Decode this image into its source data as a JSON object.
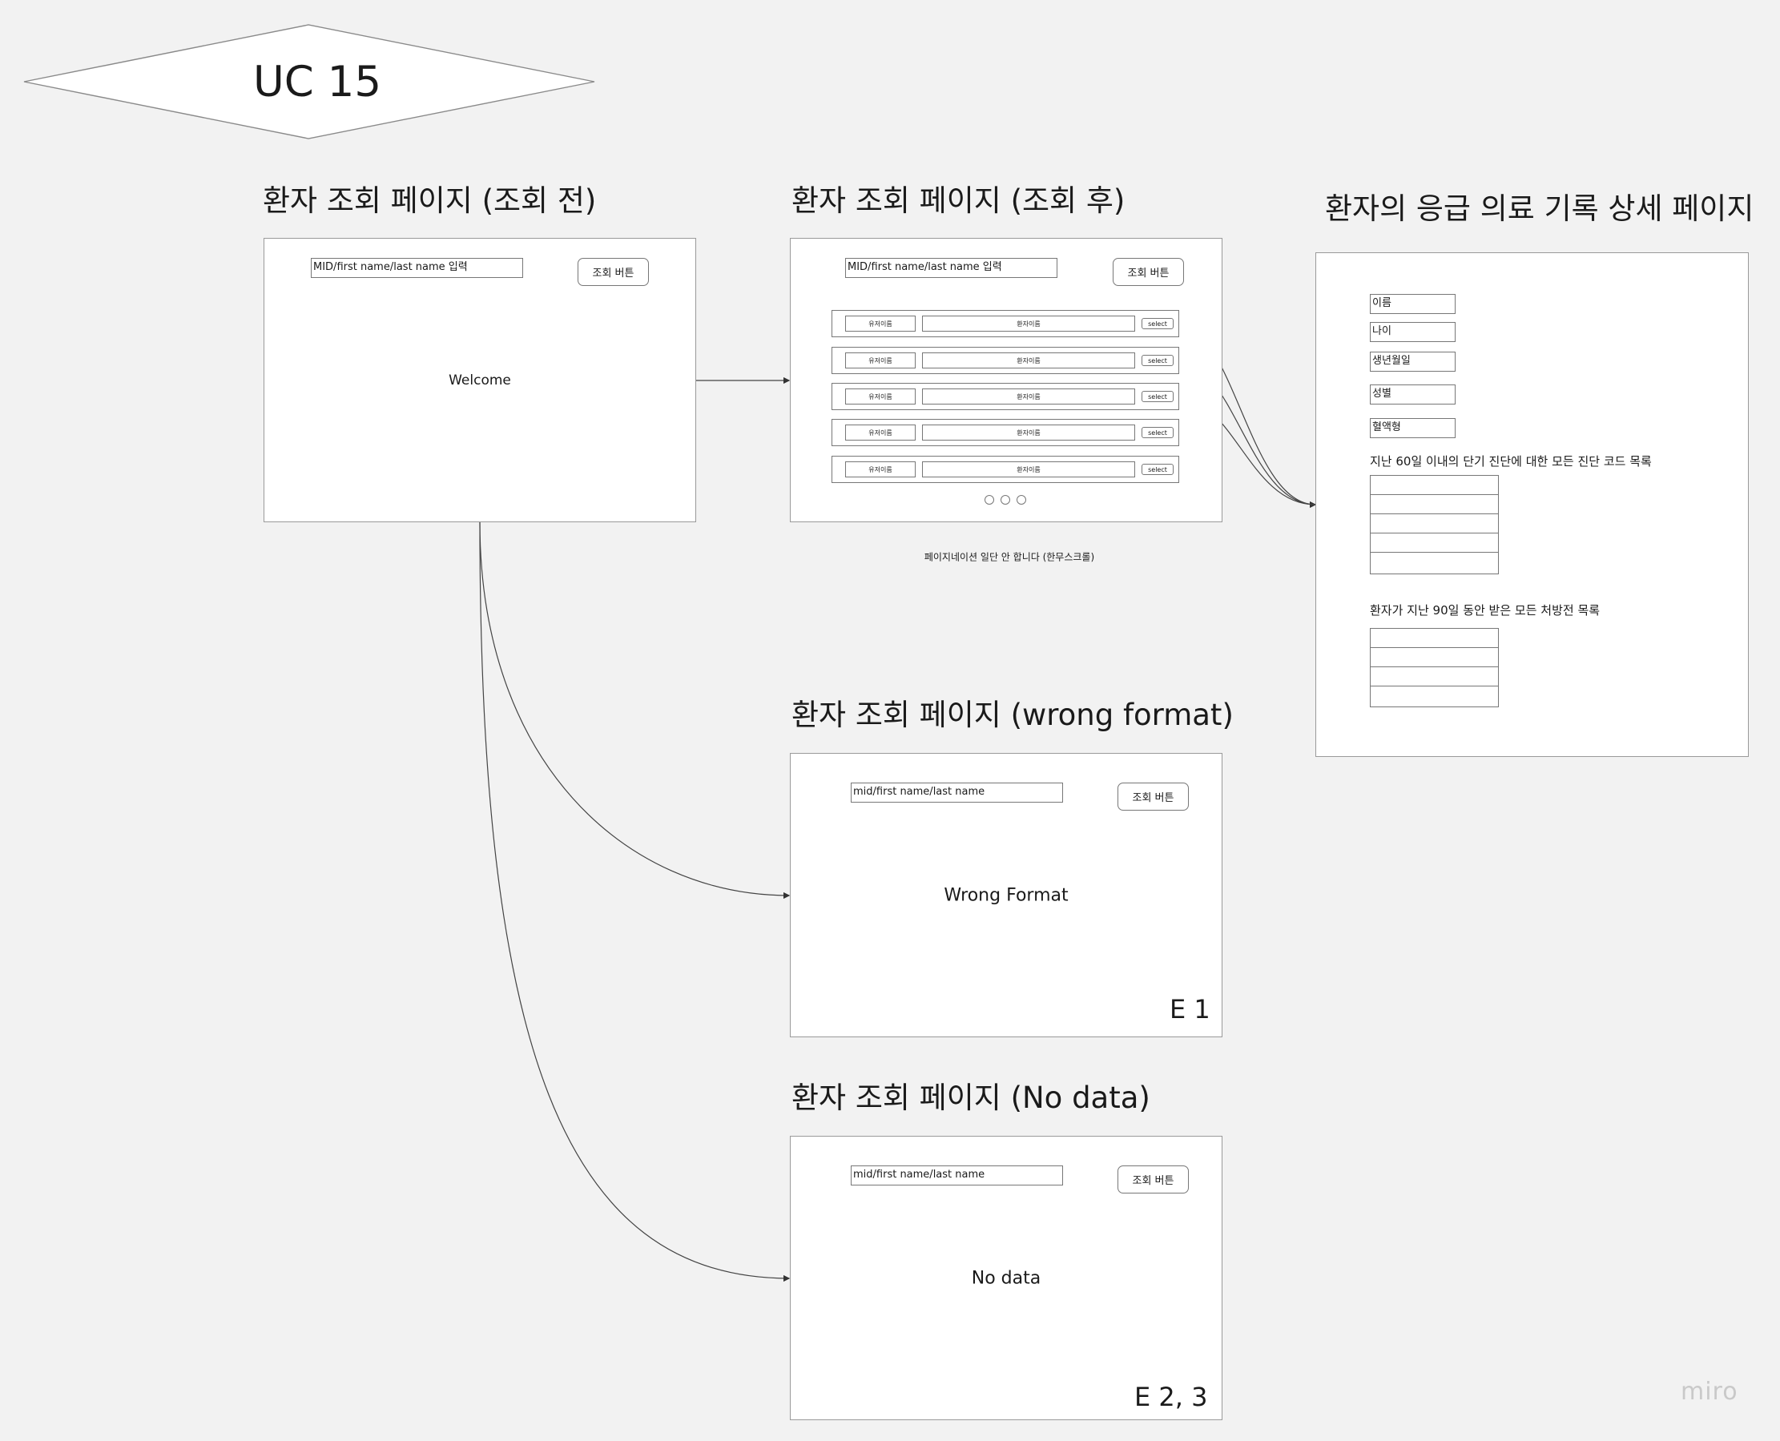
{
  "title": "UC 15",
  "screens": {
    "before": {
      "heading": "환자 조회 페이지 (조회 전)",
      "input_value": "MID/first name/last name 입력",
      "button_label": "조회 버튼",
      "message": "Welcome"
    },
    "after": {
      "heading": "환자 조회 페이지 (조회 후)",
      "input_value": "MID/first name/last name 입력",
      "button_label": "조회 버튼",
      "rows": [
        {
          "user_name": "유저이름",
          "patient_name": "환자이름",
          "select_label": "select"
        },
        {
          "user_name": "유저이름",
          "patient_name": "환자이름",
          "select_label": "select"
        },
        {
          "user_name": "유저이름",
          "patient_name": "환자이름",
          "select_label": "select"
        },
        {
          "user_name": "유저이름",
          "patient_name": "환자이름",
          "select_label": "select"
        },
        {
          "user_name": "유저이름",
          "patient_name": "환자이름",
          "select_label": "select"
        }
      ],
      "note": "페이지네이션 일단 안 합니다 (한무스크롤)"
    },
    "detail": {
      "heading": "환자의 응급 의료 기록 상세 페이지",
      "fields": [
        "이름",
        "나이",
        "생년월일",
        "성별",
        "혈액형"
      ],
      "diagnosis_label": "지난 60일 이내의 단기 진단에 대한 모든 진단 코드 목록",
      "prescription_label": "환자가 지난 90일 동안 받은 모든 처방전 목록"
    },
    "wrong_format": {
      "heading": "환자 조회 페이지 (wrong format)",
      "input_value": "mid/first name/last name",
      "button_label": "조회 버튼",
      "message": "Wrong Format",
      "code": "E 1"
    },
    "no_data": {
      "heading": "환자 조회 페이지 (No data)",
      "input_value": "mid/first name/last name",
      "button_label": "조회 버튼",
      "message": "No data",
      "code": "E 2, 3"
    }
  },
  "watermark": "miro"
}
